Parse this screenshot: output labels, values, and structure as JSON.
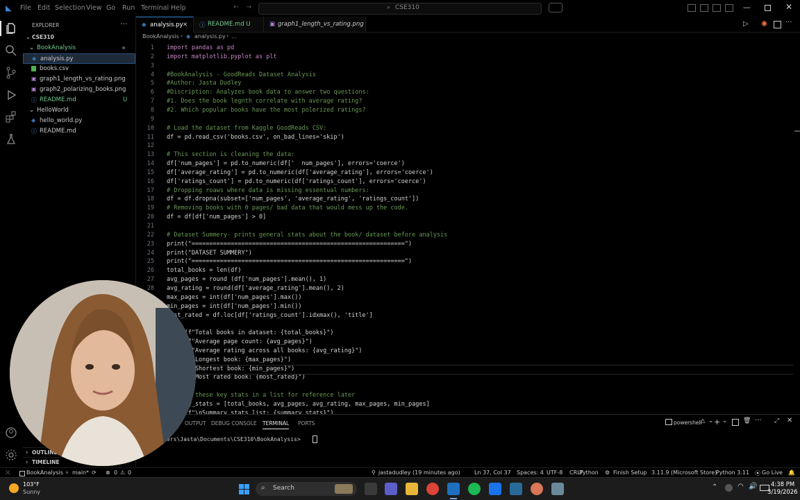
{
  "menu": [
    "File",
    "Edit",
    "Selection",
    "View",
    "Go",
    "Run",
    "Terminal",
    "Help"
  ],
  "search": {
    "label": "CSE310"
  },
  "sidebar": {
    "title": "EXPLORER",
    "workspace": "CSE310",
    "items": [
      {
        "label": "BookAnalysis",
        "kind": "folder",
        "color": "#73c991"
      },
      {
        "label": "analysis.py",
        "kind": "file",
        "color": "#cccccc"
      },
      {
        "label": "books.csv",
        "kind": "file",
        "color": "#cccccc"
      },
      {
        "label": "graph1_length_vs_rating.png",
        "kind": "file",
        "color": "#cccccc"
      },
      {
        "label": "graph2_polarizing_books.png",
        "kind": "file",
        "color": "#cccccc"
      },
      {
        "label": "README.md",
        "kind": "file",
        "color": "#73c991",
        "badge": "U"
      },
      {
        "label": "HelloWorld",
        "kind": "folder",
        "color": "#cccccc"
      },
      {
        "label": "hello_world.py",
        "kind": "file",
        "color": "#cccccc"
      },
      {
        "label": "README.md",
        "kind": "file",
        "color": "#cccccc"
      }
    ],
    "outline": "OUTLINE",
    "timeline": "TIMELINE"
  },
  "tabs": [
    {
      "label": "analysis.py",
      "active": true
    },
    {
      "label": "README.md U",
      "active": false
    },
    {
      "label": "graph1_length_vs_rating.png",
      "active": false
    }
  ],
  "breadcrumb": {
    "folder": "BookAnalysis",
    "file": "analysis.py",
    "rest": "..."
  },
  "editor": {
    "lines": [
      "import pandas as pd",
      "import matplotlib.pyplot as plt",
      "",
      "#BookAnalysis - GoodReads Dataset Analysis",
      "#Author: Jasta Dudley",
      "#Discription: Analyzes book data to answer two questions:",
      "#1. Does the book legnth correlate with average rating?",
      "#2. Which popular books have the most polerized ratings?",
      "",
      "# Load the dataset from Kaggle GoodReads CSV:",
      "df = pd.read_csv('books.csv', on_bad_lines='skip')",
      "",
      "# This section is cleaning the data:",
      "df['num_pages'] = pd.to_numeric(df['  num_pages'], errors='coerce')",
      "df['average_rating'] = pd.to_numeric(df['average_rating'], errors='coerce')",
      "df['ratings_count'] = pd.to_numeric(df['ratings_count'], errors='coerce')",
      "# Dropping roaws where data is missing essentual numbers:",
      "df = df.dropna(subset=['num_pages', 'average_rating', 'ratings_count'])",
      "# Removing books with 0 pages/ bad data that would mess up the code.",
      "df = df[df['num_pages'] > 0]",
      "",
      "# Dataset Summery- prints general stats about the book/ dataset before analysis",
      "print(\"============================================================\")",
      "print(\"DATASET SUMMERY\")",
      "print(\"============================================================\")",
      "total_books = len(df)",
      "avg_pages = round (df['num_pages'].mean(), 1)",
      "avg_rating = round(df['average_rating'].mean(), 2)",
      "max_pages = int(df['num_pages'].max())",
      "min_pages = int(df['num_pages'].min())",
      "most_rated = df.loc[df['ratings_count'].idxmax(), 'title']",
      "",
      "print(f\"Total books in dataset: {total_books}\")",
      "print(f\"Average page count: {avg_pages}\")",
      "print(f\"Average rating across all books: {avg_rating}\")",
      "print(f\"Longest book: {max_pages}\")",
      "print(f\"Shortest book: {min_pages}\")",
      "print(f\"Most rated book: {most_rated}\")",
      "",
      "# Store these key stats in a list for reference later",
      "summary_stats = [total_books, avg_pages, avg_rating, max_pages, min_pages]",
      "print(f\"\\nSummary stats list: {summary_stats}\")"
    ]
  },
  "panel": {
    "tabs": [
      "OUTPUT",
      "DEBUG CONSOLE",
      "TERMINAL",
      "PORTS"
    ],
    "active": "TERMINAL",
    "shell": "powershell",
    "prompt": "ers\\Jasta\\Documents\\CSE310\\BookAnalysis> "
  },
  "status": {
    "branch": "main*",
    "project": "BookAnalysis",
    "problems": "0",
    "warnings": "0",
    "author": "jastadudley (19 minutes ago)",
    "position": "Ln 37, Col 37",
    "spaces": "Spaces: 4",
    "encoding": "UTF-8",
    "eol": "CRLF",
    "language": "Python",
    "finish_setup": "Finish Setup",
    "interpreter": "3.11.9 (Microsoft Store)",
    "python": "Python 3.11",
    "golive": "Go Live"
  },
  "taskbar": {
    "weather_temp": "103°F",
    "weather_desc": "Sunny",
    "search": "Search",
    "time": "4:38 PM",
    "date": "3/19/2026"
  }
}
